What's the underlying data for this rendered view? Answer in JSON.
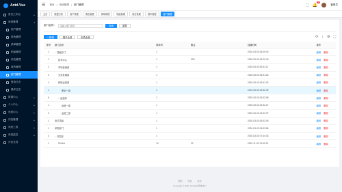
{
  "app": {
    "title": "Antd-Vue"
  },
  "sidebar": {
    "items": [
      {
        "label": "首页工作台",
        "icon": "home-icon",
        "level": 0,
        "caret": "▸",
        "active": false
      },
      {
        "label": "系统管理",
        "icon": "setting-icon",
        "level": 0,
        "caret": "▾",
        "active": false
      },
      {
        "label": "用户管理",
        "icon": "user-icon",
        "level": 1,
        "caret": "",
        "active": false
      },
      {
        "label": "角色管理",
        "icon": "team-icon",
        "level": 1,
        "caret": "",
        "active": false
      },
      {
        "label": "菜单管理",
        "icon": "menu-icon",
        "level": 1,
        "caret": "",
        "active": false
      },
      {
        "label": "职级管理",
        "icon": "rank-icon",
        "level": 1,
        "caret": "",
        "active": false
      },
      {
        "label": "岗位管理",
        "icon": "post-icon",
        "level": 1,
        "caret": "",
        "active": false
      },
      {
        "label": "城市管理",
        "icon": "city-icon",
        "level": 1,
        "caret": "",
        "active": false
      },
      {
        "label": "部门管理",
        "icon": "dept-icon",
        "level": 1,
        "caret": "",
        "active": true
      },
      {
        "label": "登录日志",
        "icon": "log-icon",
        "level": 1,
        "caret": "",
        "active": false
      },
      {
        "label": "操作日志",
        "icon": "operlog-icon",
        "level": 1,
        "caret": "",
        "active": false
      },
      {
        "label": "数据中心",
        "icon": "database-icon",
        "level": 0,
        "caret": "▸",
        "active": false
      },
      {
        "label": "个人中心",
        "icon": "profile-icon",
        "level": 0,
        "caret": "▸",
        "active": false
      },
      {
        "label": "系统中心",
        "icon": "system-icon",
        "level": 0,
        "caret": "▸",
        "active": false
      },
      {
        "label": "内容管理",
        "icon": "content-icon",
        "level": 0,
        "caret": "▸",
        "active": false
      },
      {
        "label": "系统工具",
        "icon": "tool-icon",
        "level": 0,
        "caret": "▸",
        "active": false
      },
      {
        "label": "系统监控",
        "icon": "monitor-icon",
        "level": 0,
        "caret": "▸",
        "active": false
      },
      {
        "label": "开发文档",
        "icon": "doc-icon",
        "level": 0,
        "caret": "",
        "active": false
      }
    ]
  },
  "header": {
    "breadcrumb": [
      "首页",
      "系统管理",
      "部门管理"
    ],
    "notification_count": "99",
    "user_name": "管理员"
  },
  "tabs": [
    {
      "label": "主页",
      "active": false
    },
    {
      "label": "数据分析",
      "active": false
    },
    {
      "label": "用户管理",
      "active": false
    },
    {
      "label": "角色管理",
      "active": false
    },
    {
      "label": "菜单管理",
      "active": false
    },
    {
      "label": "职级管理",
      "active": false
    },
    {
      "label": "岗位管理",
      "active": false
    },
    {
      "label": "城市管理",
      "active": false
    },
    {
      "label": "部门管理",
      "active": true
    }
  ],
  "search": {
    "label": "部门名称：",
    "placeholder": "请输入部门名称",
    "search_button": "查询",
    "reset_button": "重置"
  },
  "toolbar": {
    "add_button": "+ 新增",
    "expand_button": "展开全部",
    "collapse_button": "折叠全部"
  },
  "table": {
    "columns": [
      "序号",
      "部门名称",
      "排序号",
      "备注",
      "创建时间",
      "操作"
    ],
    "edit_label": "编辑",
    "delete_label": "删除",
    "rows": [
      {
        "no": "1",
        "name": "顶级部门",
        "sort": "1",
        "remark": "",
        "time": "2020-03-03 06:29:40",
        "expandable": true,
        "indent": 0,
        "highlight": false
      },
      {
        "no": "1",
        "name": "技术中心",
        "sort": "1",
        "remark": "333",
        "time": "2020-03-03 06:29:40",
        "expandable": false,
        "indent": 1,
        "highlight": false
      },
      {
        "no": "2",
        "name": "市场营销部",
        "sort": "1",
        "remark": "",
        "time": "2020-03-03 06:31:11",
        "expandable": false,
        "indent": 1,
        "highlight": false
      },
      {
        "no": "3",
        "name": "业务发展部",
        "sort": "1",
        "remark": "",
        "time": "2020-03-03 06:31:18",
        "expandable": false,
        "indent": 1,
        "highlight": false
      },
      {
        "no": "4",
        "name": "网络运营部",
        "sort": "1",
        "remark": "",
        "time": "2020-03-03 06:31:32",
        "expandable": false,
        "indent": 1,
        "highlight": false
      },
      {
        "no": "1",
        "name": "策划一部",
        "sort": "1",
        "remark": "",
        "time": "2020-03-03 06:32:39",
        "expandable": false,
        "indent": 2,
        "highlight": true
      },
      {
        "no": "6",
        "name": "运营部",
        "sort": "1",
        "remark": "",
        "time": "2020-03-03 06:32:08",
        "expandable": true,
        "indent": 1,
        "highlight": false
      },
      {
        "no": "1",
        "name": "运营一部",
        "sort": "1",
        "remark": "",
        "time": "2020-03-03 06:32:27",
        "expandable": false,
        "indent": 2,
        "highlight": false
      },
      {
        "no": "2",
        "name": "运营二部",
        "sort": "1",
        "remark": "",
        "time": "2020-03-03 06:32:37",
        "expandable": false,
        "indent": 2,
        "highlight": false
      },
      {
        "no": "1",
        "name": "测试顶级",
        "sort": "1",
        "remark": "",
        "time": "2020-03-03 06:32:49",
        "expandable": false,
        "indent": 0,
        "highlight": false
      },
      {
        "no": "1",
        "name": "采购部门",
        "sort": "1",
        "remark": "",
        "time": "2020-03-03 06:32:56",
        "expandable": false,
        "indent": 0,
        "highlight": false
      },
      {
        "no": "3",
        "name": "开发部",
        "sort": "1",
        "remark": "",
        "time": "2020-03-03 07:44:33",
        "expandable": true,
        "indent": 0,
        "highlight": false
      },
      {
        "no": "1",
        "name": "22AAA",
        "sort": "12",
        "remark": "22",
        "time": "2020-11-03 13:51:20",
        "expandable": false,
        "indent": 1,
        "highlight": false
      }
    ]
  },
  "footer": {
    "links": [
      "帮助",
      "隐私",
      "条款"
    ],
    "copyright": "Copyright © 2021 JavaWeb研发中心"
  },
  "colors": {
    "primary": "#1890ff",
    "sidebar_bg": "#001529",
    "danger": "#f5222d"
  }
}
